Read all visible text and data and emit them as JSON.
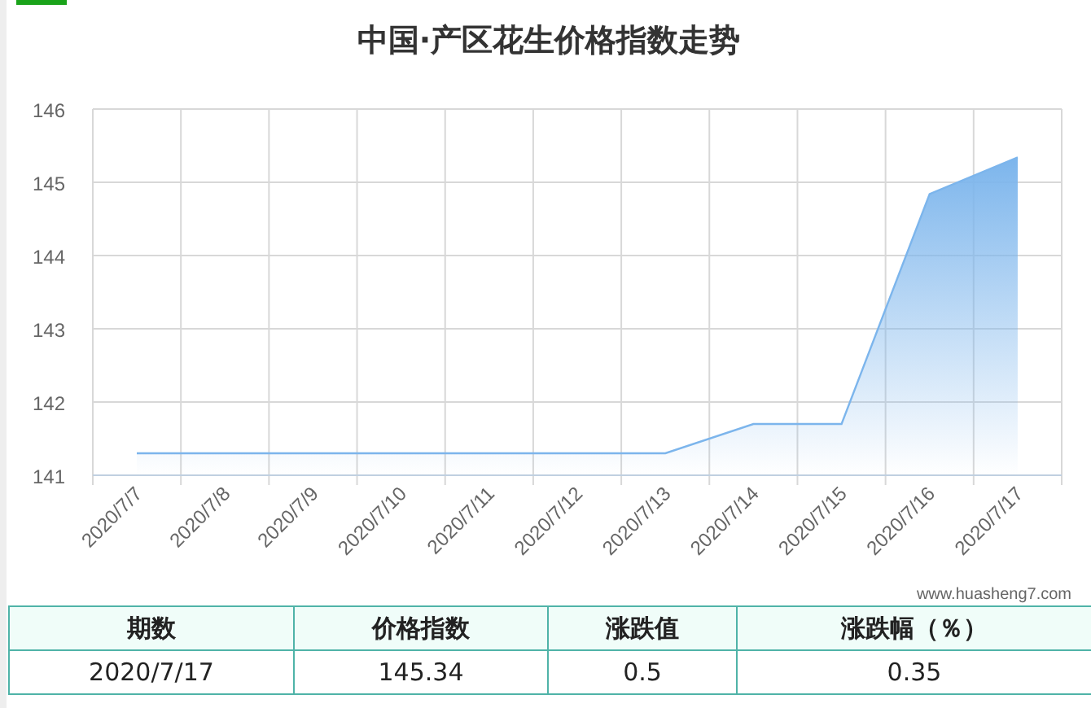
{
  "title": "中国·产区花生价格指数走势",
  "chart_data": {
    "type": "area",
    "categories": [
      "2020/7/7",
      "2020/7/8",
      "2020/7/9",
      "2020/7/10",
      "2020/7/11",
      "2020/7/12",
      "2020/7/13",
      "2020/7/14",
      "2020/7/15",
      "2020/7/16",
      "2020/7/17"
    ],
    "series": [
      {
        "color": "#7cb5ec",
        "values": [
          141.3,
          141.3,
          141.3,
          141.3,
          141.3,
          141.3,
          141.3,
          141.7,
          141.7,
          144.84,
          145.34
        ]
      }
    ],
    "grid": true,
    "ylim": [
      141,
      146
    ],
    "yticks": [
      141,
      142,
      143,
      144,
      145,
      146
    ]
  },
  "credit": "www.huasheng7.com",
  "table": {
    "columns": [
      "期数",
      "价格指数",
      "涨跌值",
      "涨跌幅（％）"
    ],
    "rows": [
      [
        "2020/7/17",
        "145.34",
        "0.5",
        "0.35"
      ]
    ]
  }
}
